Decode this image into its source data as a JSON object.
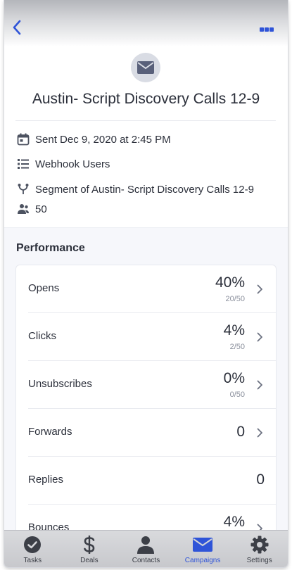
{
  "header": {
    "back_icon": "chevron-left-icon",
    "more_icon": "more-dots-icon",
    "accent": "#2f54d8"
  },
  "campaign": {
    "icon": "envelope-icon",
    "title": "Austin- Script Discovery Calls 12-9",
    "sent": "Sent Dec 9, 2020 at 2:45 PM",
    "list": "Webhook Users",
    "segment": "Segment of Austin- Script Discovery Calls 12-9",
    "recipients": "50"
  },
  "performance": {
    "title": "Performance",
    "rows": [
      {
        "label": "Opens",
        "value": "40%",
        "sub": "20/50",
        "chevron": true
      },
      {
        "label": "Clicks",
        "value": "4%",
        "sub": "2/50",
        "chevron": true
      },
      {
        "label": "Unsubscribes",
        "value": "0%",
        "sub": "0/50",
        "chevron": true
      },
      {
        "label": "Forwards",
        "value": "0",
        "sub": "",
        "chevron": true
      },
      {
        "label": "Replies",
        "value": "0",
        "sub": "",
        "chevron": false
      },
      {
        "label": "Bounces",
        "value": "4%",
        "sub": "",
        "chevron": true
      }
    ]
  },
  "tabbar": {
    "tabs": [
      {
        "label": "Tasks",
        "icon": "check-circle-icon"
      },
      {
        "label": "Deals",
        "icon": "dollar-icon"
      },
      {
        "label": "Contacts",
        "icon": "person-icon"
      },
      {
        "label": "Campaigns",
        "icon": "envelope-icon",
        "active": true
      },
      {
        "label": "Settings",
        "icon": "gear-icon"
      }
    ]
  }
}
